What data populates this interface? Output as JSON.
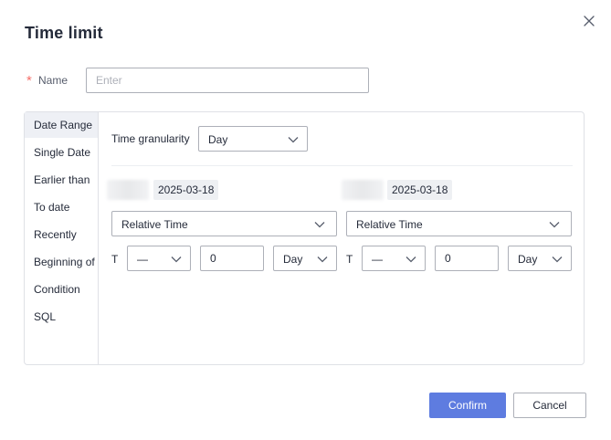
{
  "dialog": {
    "title": "Time limit",
    "close_icon": "close-icon"
  },
  "name_field": {
    "required_mark": "*",
    "label": "Name",
    "value": "",
    "placeholder": "Enter"
  },
  "sidebar": {
    "active_index": 0,
    "items": [
      {
        "label": "Date Range"
      },
      {
        "label": "Single Date"
      },
      {
        "label": "Earlier than"
      },
      {
        "label": "To date"
      },
      {
        "label": "Recently"
      },
      {
        "label": "Beginning of"
      },
      {
        "label": "Condition"
      },
      {
        "label": "SQL"
      }
    ]
  },
  "granularity": {
    "label": "Time granularity",
    "value": "Day"
  },
  "start": {
    "date": "2025-03-18",
    "mode": "Relative Time",
    "t_label": "T",
    "operator": "—",
    "offset": "0",
    "unit": "Day"
  },
  "end": {
    "date": "2025-03-18",
    "mode": "Relative Time",
    "t_label": "T",
    "operator": "—",
    "offset": "0",
    "unit": "Day"
  },
  "footer": {
    "confirm_label": "Confirm",
    "cancel_label": "Cancel"
  },
  "colors": {
    "primary": "#5e7ce0",
    "required": "#f66f6a",
    "active_tab_bg": "#eef0f5",
    "border": "#adb0b8"
  }
}
